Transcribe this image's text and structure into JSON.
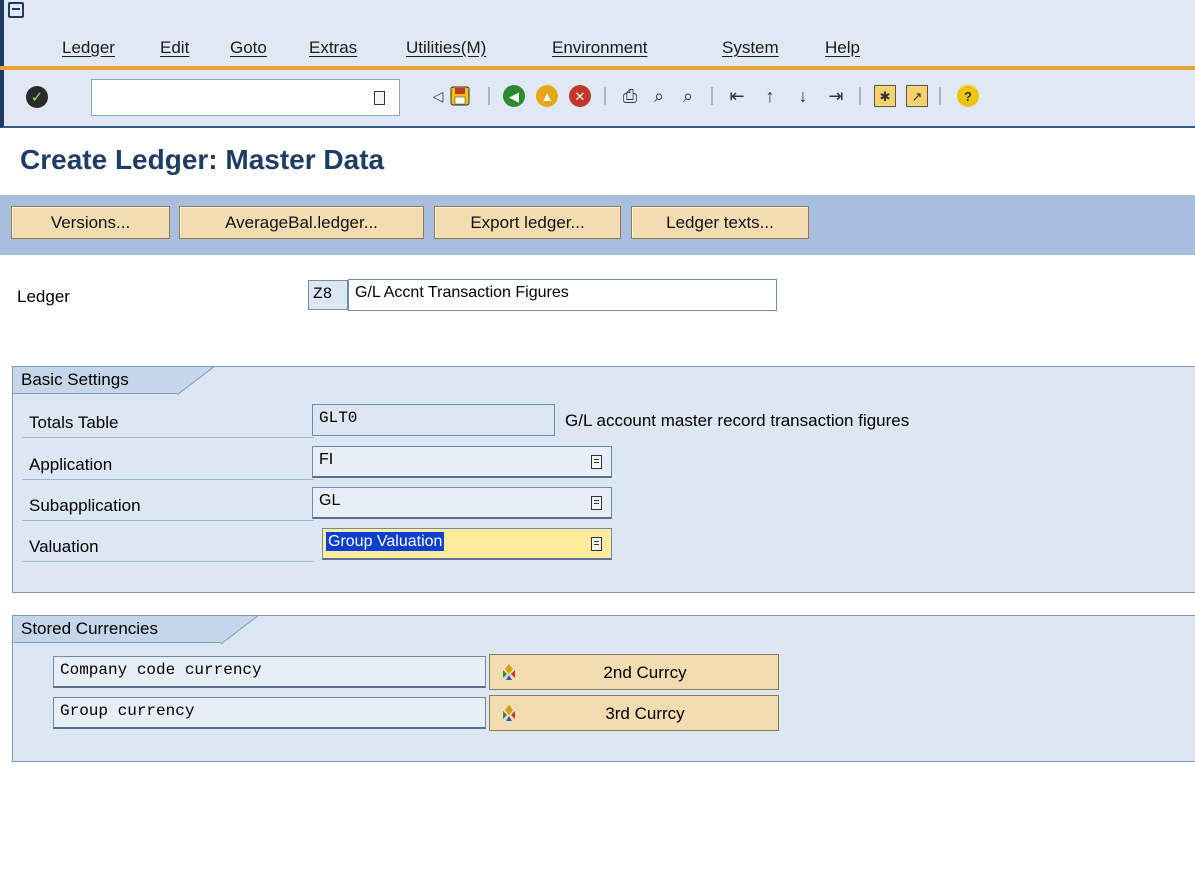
{
  "menu": {
    "items": [
      "Ledger",
      "Edit",
      "Goto",
      "Extras",
      "Utilities(M)",
      "Environment",
      "System",
      "Help"
    ]
  },
  "toolbar": {
    "command_field_value": "",
    "icons": [
      "enter-icon",
      "back-arrow-icon",
      "save-icon",
      "back-icon",
      "exit-icon",
      "cancel-icon",
      "print-icon",
      "find-icon",
      "find-next-icon",
      "first-page-icon",
      "previous-page-icon",
      "next-page-icon",
      "last-page-icon",
      "create-session-icon",
      "shortcut-icon",
      "help-icon"
    ]
  },
  "page": {
    "title": "Create Ledger: Master Data"
  },
  "app_toolbar": {
    "buttons": [
      "Versions...",
      "AverageBal.ledger...",
      "Export ledger...",
      "Ledger texts..."
    ]
  },
  "ledger": {
    "label": "Ledger",
    "code": "Z8",
    "description": "G/L Accnt Transaction Figures"
  },
  "basic_settings": {
    "title": "Basic Settings",
    "rows": [
      {
        "label": "Totals Table",
        "value": "GLT0",
        "description": "G/L account master record transaction figures"
      },
      {
        "label": "Application",
        "value": "FI"
      },
      {
        "label": "Subapplication",
        "value": "GL"
      },
      {
        "label": "Valuation",
        "value": "Group Valuation"
      }
    ]
  },
  "stored_currencies": {
    "title": "Stored Currencies",
    "rows": [
      {
        "label": "Company code currency",
        "button": "2nd Currcy"
      },
      {
        "label": "Group currency",
        "button": "3rd Currcy"
      }
    ]
  },
  "colors": {
    "title_blue": "#1f3d63",
    "button_tan": "#f4dcb1",
    "app_toolbar_blue": "#a7bfdc",
    "highlight_yellow": "#ffeb9c",
    "selection_blue": "#0a3fd1"
  }
}
